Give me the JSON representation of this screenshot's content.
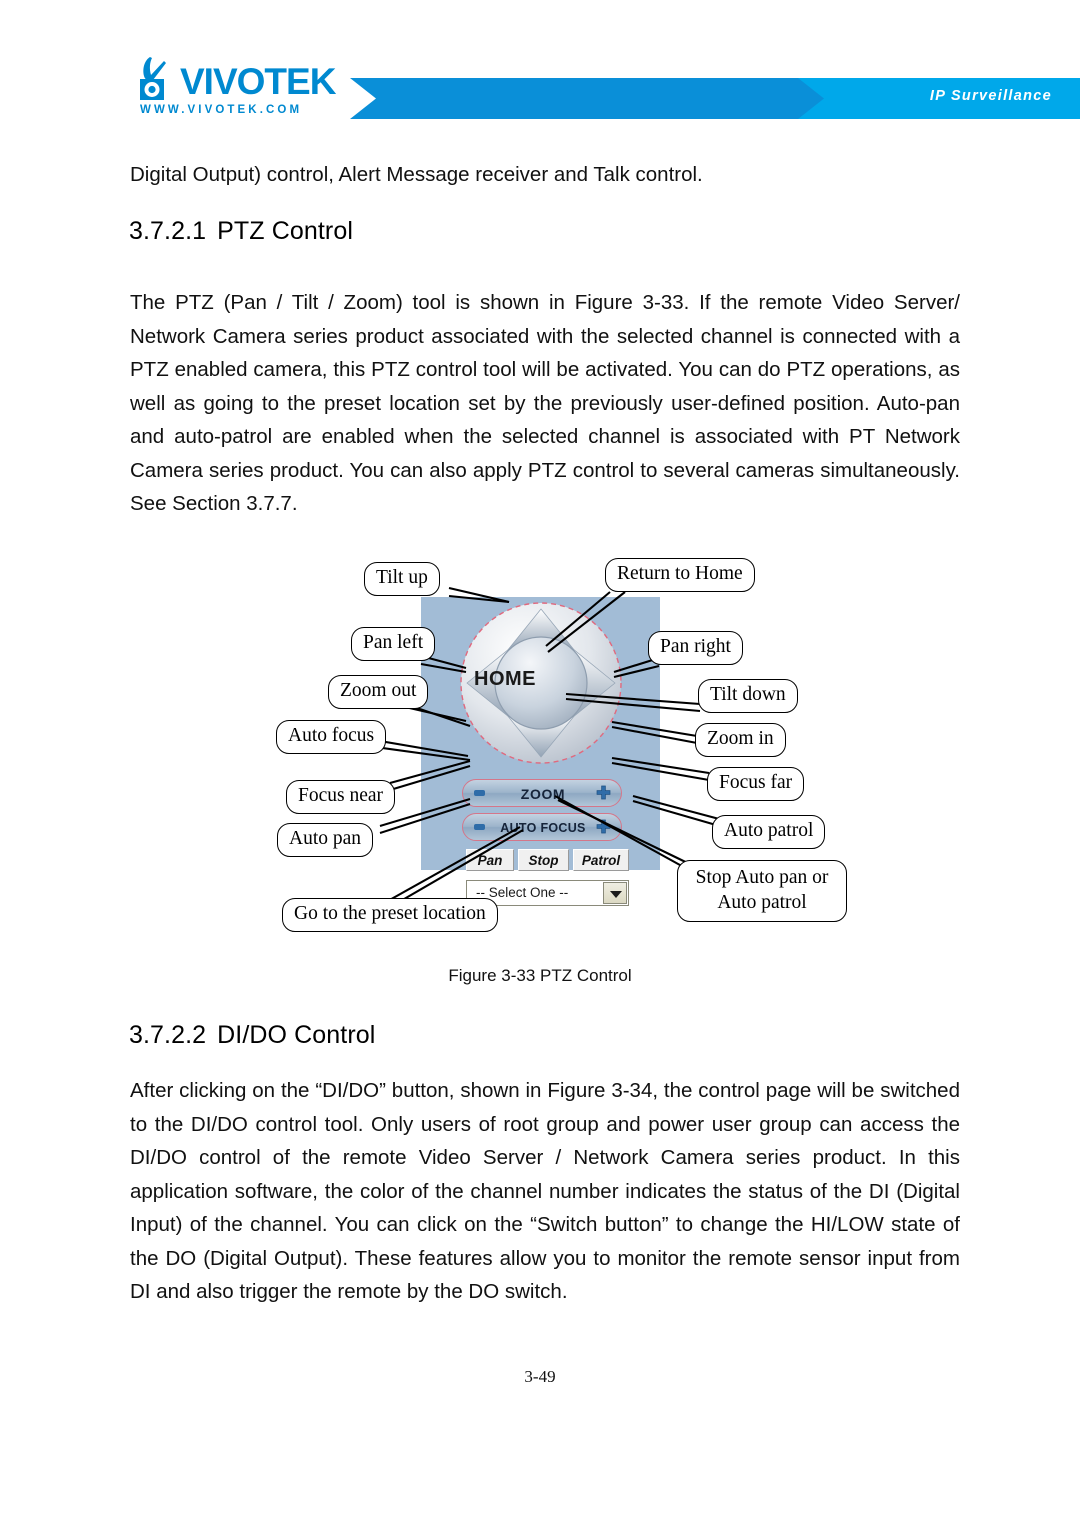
{
  "header": {
    "logo_wordmark": "VIVOTEK",
    "logo_url": "WWW.VIVOTEK.COM",
    "banner_tag": "IP Surveillance",
    "brand_color": "#0089d0",
    "banner_color": "#00a0e4"
  },
  "document": {
    "intro_line": "Digital Output) control, Alert Message receiver and Talk control.",
    "heading_ptz": {
      "number": "3.7.2.1",
      "title": "PTZ Control"
    },
    "ptz_paragraph": "The PTZ (Pan / Tilt / Zoom) tool is shown in Figure 3-33. If the remote Video Server/ Network Camera series product associated with the selected channel is connected with a PTZ enabled camera, this PTZ control tool will be activated. You can do PTZ operations, as well as going to the preset location set by the previously user-defined position. Auto-pan and auto-patrol are enabled when the selected channel is associated with PT Network Camera series product. You can also apply PTZ control to several cameras simultaneously. See Section 3.7.7.",
    "figure_caption": "Figure 3-33 PTZ Control",
    "heading_dido": {
      "number": "3.7.2.2",
      "title": "DI/DO Control"
    },
    "dido_paragraph": "After clicking on the “DI/DO” button, shown in Figure 3-34, the control page will be switched to the DI/DO control tool. Only users of root group and power user group can access the DI/DO control of the remote Video Server / Network Camera series product. In this application software, the color of the channel number indicates the status of the DI (Digital Input) of the channel. You can click on the “Switch button” to change the HI/LOW state of the DO (Digital Output). These features allow you to monitor the remote sensor input from DI and also trigger the remote by the DO switch.",
    "page_number": "3-49"
  },
  "ptz_tool": {
    "panel_color": "#a2bcd6",
    "home_label": "HOME",
    "zoom_label": "ZOOM",
    "autofocus_label": "AUTO FOCUS",
    "buttons": {
      "pan": "Pan",
      "stop": "Stop",
      "patrol": "Patrol"
    },
    "preset_select_value": "-- Select One --"
  },
  "callouts": {
    "tilt_up": "Tilt up",
    "return_to_home": "Return to Home",
    "pan_left": "Pan left",
    "pan_right": "Pan right",
    "zoom_out": "Zoom out",
    "tilt_down": "Tilt down",
    "auto_focus": "Auto focus",
    "zoom_in": "Zoom in",
    "focus_near": "Focus near",
    "focus_far": "Focus far",
    "auto_pan": "Auto pan",
    "auto_patrol": "Auto patrol",
    "stop_auto": "Stop Auto pan or Auto patrol",
    "go_to_preset": "Go to the preset location"
  }
}
